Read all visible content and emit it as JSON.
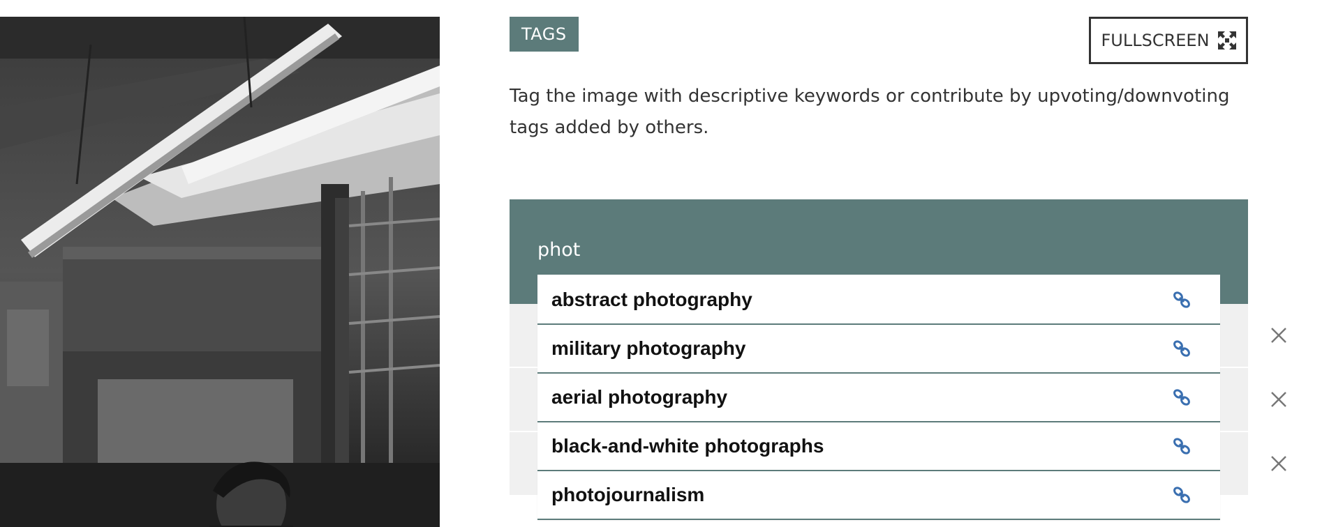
{
  "tags_section": {
    "badge_label": "TAGS",
    "fullscreen_label": "FULLSCREEN",
    "fullscreen_icon": "expand-arrows-icon",
    "description": "Tag the image with descriptive keywords or contribute by upvoting/downvoting tags added by others."
  },
  "search": {
    "value": "phot"
  },
  "suggestions": [
    {
      "label": "abstract photography",
      "icon": "link-icon"
    },
    {
      "label": "military photography",
      "icon": "link-icon"
    },
    {
      "label": "aerial photography",
      "icon": "link-icon"
    },
    {
      "label": "black-and-white photographs",
      "icon": "link-icon"
    },
    {
      "label": "photojournalism",
      "icon": "link-icon"
    }
  ],
  "existing_tags": {
    "remove_icon": "close-icon",
    "count_visible": 3
  },
  "colors": {
    "accent": "#5c7b7a",
    "link_icon": "#3a6fb0",
    "text": "#333333",
    "row_bg": "#f0f0f0"
  }
}
